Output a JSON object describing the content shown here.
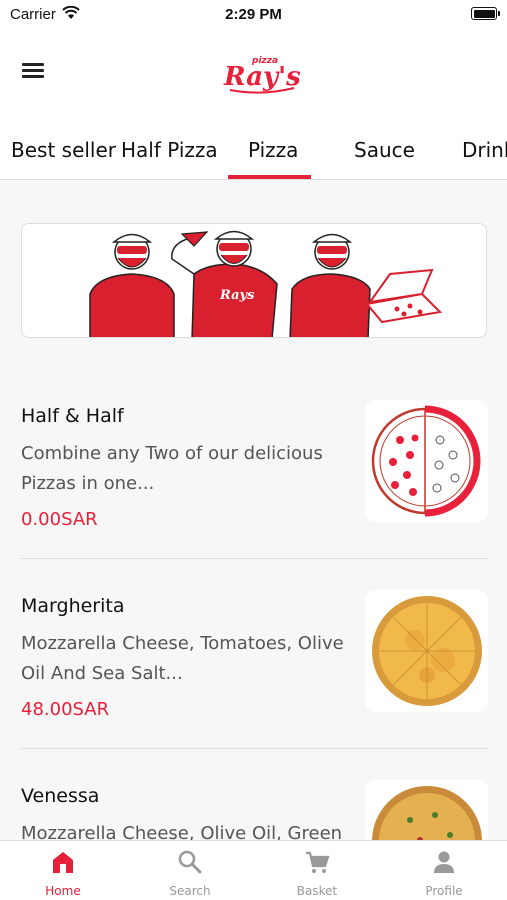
{
  "status_bar": {
    "carrier": "Carrier",
    "time": "2:29 PM"
  },
  "header": {
    "logo_text": "Ray's",
    "logo_subtext": "pizza"
  },
  "tabs": [
    {
      "label": "Best seller"
    },
    {
      "label": "Half Pizza"
    },
    {
      "label": "Pizza",
      "active": true
    },
    {
      "label": "Sauce"
    },
    {
      "label": "Drink"
    }
  ],
  "products": [
    {
      "name": "Half & Half",
      "description": "Combine any Two of our delicious Pizzas in one...",
      "price": "0.00SAR"
    },
    {
      "name": "Margherita",
      "description": "Mozzarella Cheese, Tomatoes, Olive Oil And Sea Salt...",
      "price": "48.00SAR"
    },
    {
      "name": "Venessa",
      "description": "Mozzarella Cheese, Olive Oil, Green"
    }
  ],
  "bottom_nav": [
    {
      "label": "Home",
      "icon": "home-icon",
      "active": true
    },
    {
      "label": "Search",
      "icon": "search-icon"
    },
    {
      "label": "Basket",
      "icon": "cart-icon"
    },
    {
      "label": "Profile",
      "icon": "profile-icon"
    }
  ],
  "colors": {
    "accent": "#e8203a",
    "text": "#222222",
    "muted": "#999999"
  }
}
